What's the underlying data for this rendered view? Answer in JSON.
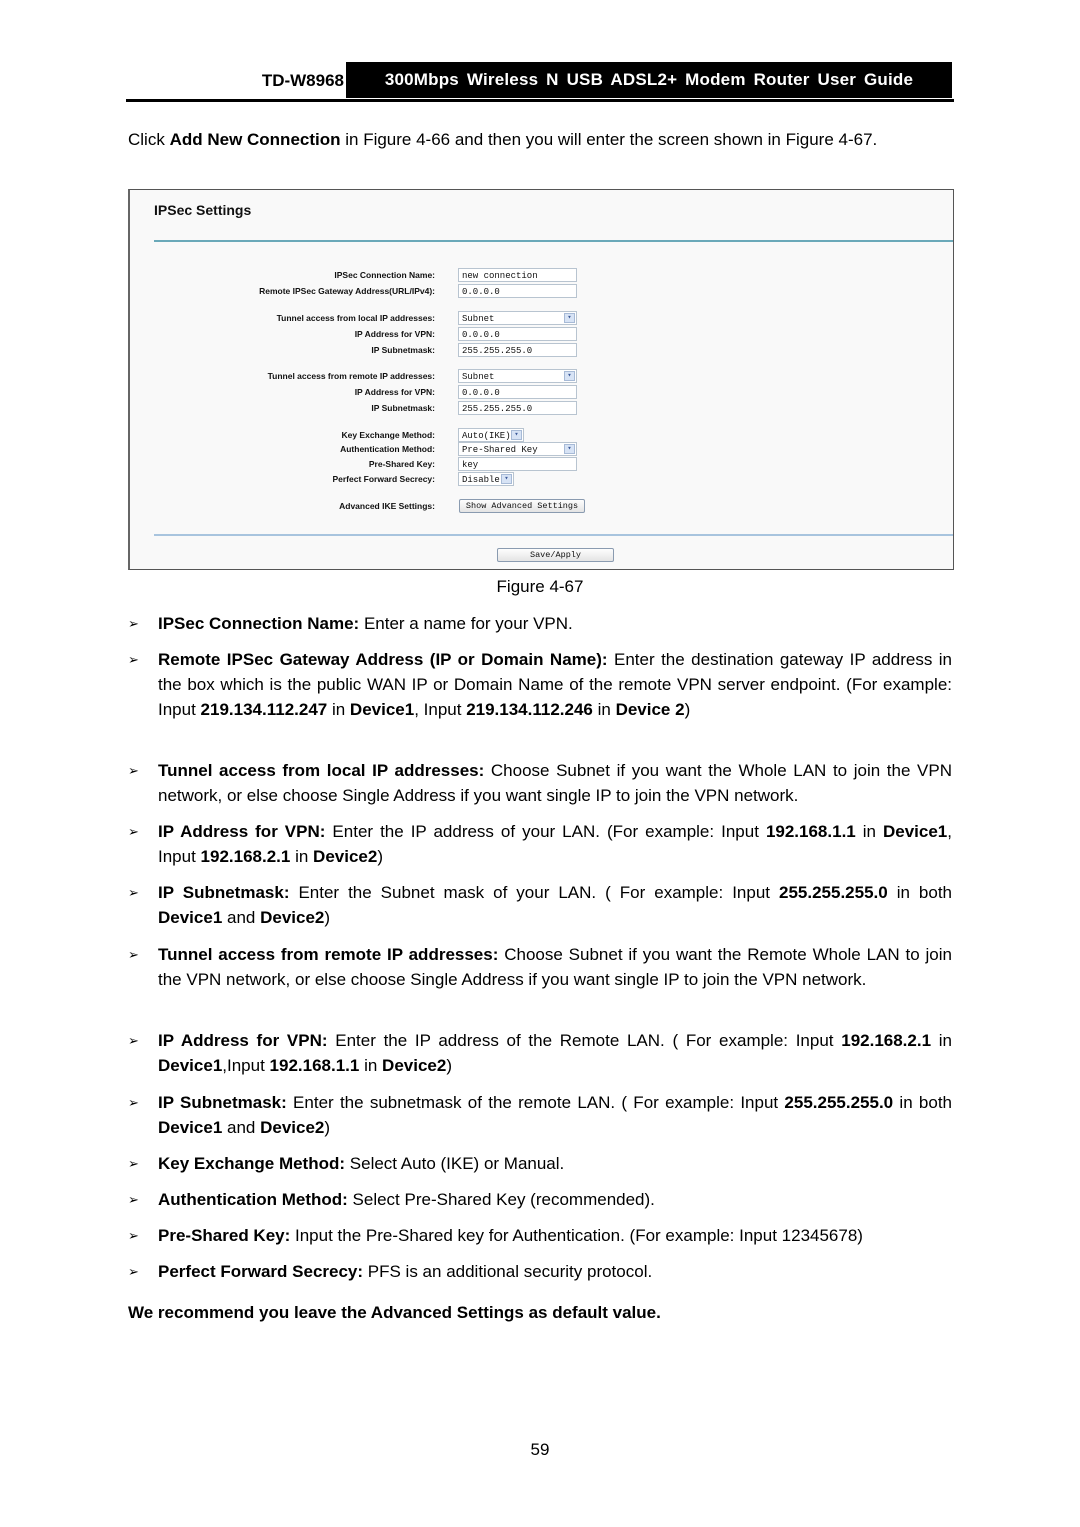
{
  "header": {
    "model": "TD-W8968",
    "guide_title": "300Mbps Wireless N USB ADSL2+ Modem Router User Guide"
  },
  "intro": {
    "t1": "Click ",
    "b1": "Add New Connection",
    "t2": " in Figure 4-66 and then you will enter the screen shown in Figure 4-67."
  },
  "figure": {
    "title": "IPSec Settings",
    "caption": "Figure 4-67",
    "fields": {
      "conn_name": {
        "label": "IPSec Connection Name:",
        "value": "new connection"
      },
      "remote_gw": {
        "label": "Remote IPSec Gateway Address(URL/IPv4):",
        "value": "0.0.0.0"
      },
      "local_access": {
        "label": "Tunnel access from local IP addresses:",
        "value": "Subnet"
      },
      "local_ip": {
        "label": "IP Address for VPN:",
        "value": "0.0.0.0"
      },
      "local_mask": {
        "label": "IP Subnetmask:",
        "value": "255.255.255.0"
      },
      "remote_access": {
        "label": "Tunnel access from remote IP addresses:",
        "value": "Subnet"
      },
      "remote_ip": {
        "label": "IP Address for VPN:",
        "value": "0.0.0.0"
      },
      "remote_mask": {
        "label": "IP Subnetmask:",
        "value": "255.255.255.0"
      },
      "key_exchange": {
        "label": "Key Exchange Method:",
        "value": "Auto(IKE)"
      },
      "auth_method": {
        "label": "Authentication Method:",
        "value": "Pre-Shared Key"
      },
      "psk": {
        "label": "Pre-Shared Key:",
        "value": "key"
      },
      "pfs": {
        "label": "Perfect Forward Secrecy:",
        "value": "Disable"
      },
      "advanced": {
        "label": "Advanced IKE Settings:",
        "button": "Show Advanced Settings"
      }
    },
    "save_button": "Save/Apply",
    "dropdown_arrow": "▾"
  },
  "bullets": [
    {
      "b": "IPSec Connection Name:",
      "t": " Enter a name for your VPN."
    },
    {
      "b": "Remote IPSec Gateway Address (IP or Domain Name):",
      "t": " Enter the destination gateway IP address in the box which is the public WAN IP or Domain Name of the remote VPN server endpoint. (For example: Input ",
      "b2": "219.134.112.247",
      "t2": " in ",
      "b3": "Device1",
      "t3": ", Input ",
      "b4": "219.134.112.246",
      "t4": " in ",
      "b5": "Device 2",
      "t5": ")"
    },
    {
      "b": "Tunnel access from local IP addresses:",
      "t": " Choose Subnet if you want the Whole LAN to join the VPN network, or else choose Single Address if you want single IP to join the VPN network."
    },
    {
      "b": "IP Address for VPN:",
      "t": " Enter the IP address of your LAN. (For example: Input ",
      "b2": "192.168.1.1",
      "t2": " in ",
      "b3": "Device1",
      "t3": ", Input ",
      "b4": "192.168.2.1",
      "t4": " in ",
      "b5": "Device2",
      "t5": ")"
    },
    {
      "b": "IP Subnetmask:",
      "t": " Enter the Subnet mask of your LAN. ( For example: Input ",
      "b2": "255.255.255.0",
      "t2": " in both ",
      "b3": "Device1",
      "t3": " and ",
      "b4": "Device2",
      "t4": ")"
    },
    {
      "b": "Tunnel access from remote IP addresses:",
      "t": " Choose Subnet if you want the Remote Whole LAN to join the VPN network, or else choose Single Address if you want single IP to join the VPN network."
    },
    {
      "b": "IP Address for VPN:",
      "t": " Enter the IP address of the Remote LAN. ( For example: Input ",
      "b2": "192.168.2.1",
      "t2": " in ",
      "b3": "Device1",
      "t3": ",Input ",
      "b4": "192.168.1.1",
      "t4": " in ",
      "b5": "Device2",
      "t5": ")"
    },
    {
      "b": "IP Subnetmask:",
      "t": " Enter the subnetmask of the remote LAN. ( For example: Input ",
      "b2": "255.255.255.0",
      "t2": " in both ",
      "b3": "Device1",
      "t3": " and ",
      "b4": "Device2",
      "t4": ")"
    },
    {
      "b": "Key Exchange Method:",
      "t": " Select Auto (IKE) or Manual."
    },
    {
      "b": "Authentication Method:",
      "t": " Select Pre-Shared Key (recommended)."
    },
    {
      "b": "Pre-Shared Key:",
      "t": " Input the Pre-Shared key for Authentication. (For example: Input 12345678)"
    },
    {
      "b": "Perfect Forward Secrecy:",
      "t": " PFS is an additional security protocol."
    }
  ],
  "bullet_mark": "➢",
  "recommendation": "We recommend you leave the Advanced Settings as default value.",
  "page_number": "59"
}
